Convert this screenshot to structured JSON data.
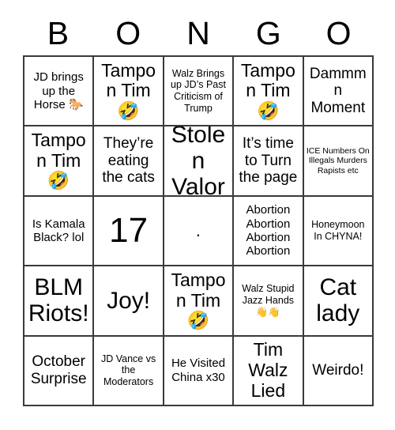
{
  "header": {
    "letters": [
      "B",
      "O",
      "N",
      "G",
      "O"
    ]
  },
  "grid": {
    "rows": 5,
    "columns": 5,
    "border_color": "#3a3a3a",
    "background": "#ffffff",
    "cells": [
      {
        "text": "JD brings up the Horse 🐎",
        "size": "s-md",
        "name": "bingo-cell-b1"
      },
      {
        "text": "Tampon Tim 🤣",
        "size": "s-xl",
        "name": "bingo-cell-o1"
      },
      {
        "text": "Walz Brings up JD’s Past Criticism of Trump",
        "size": "s-sm",
        "name": "bingo-cell-n1"
      },
      {
        "text": "Tampon Tim 🤣",
        "size": "s-xl",
        "name": "bingo-cell-g1"
      },
      {
        "text": "Dammmn Moment",
        "size": "s-lg",
        "name": "bingo-cell-o2"
      },
      {
        "text": "Tampon Tim 🤣",
        "size": "s-xl",
        "name": "bingo-cell-b2"
      },
      {
        "text": "They’re eating the cats",
        "size": "s-lg",
        "name": "bingo-cell-o3"
      },
      {
        "text": "Stolen Valor",
        "size": "s-xxl",
        "name": "bingo-cell-n2"
      },
      {
        "text": "It’s time to Turn the page",
        "size": "s-lg",
        "name": "bingo-cell-g2"
      },
      {
        "text": "ICE Numbers On Illegals Murders Rapists etc",
        "size": "s-xs",
        "name": "bingo-cell-o4"
      },
      {
        "text": "Is Kamala Black? lol",
        "size": "s-md",
        "name": "bingo-cell-b3"
      },
      {
        "text": "17",
        "size": "s-huge",
        "name": "bingo-cell-o5"
      },
      {
        "text": ".",
        "size": "s-dot",
        "name": "bingo-cell-free-center"
      },
      {
        "text": "Abortion Abortion Abortion Abortion",
        "size": "s-md",
        "name": "bingo-cell-g3"
      },
      {
        "text": "Honeymoon In CHYNA!",
        "size": "s-sm",
        "name": "bingo-cell-o6"
      },
      {
        "text": "BLM Riots!",
        "size": "s-xxl",
        "name": "bingo-cell-b4"
      },
      {
        "text": "Joy!",
        "size": "s-xxl",
        "name": "bingo-cell-o7"
      },
      {
        "text": "Tampon Tim 🤣",
        "size": "s-xl",
        "name": "bingo-cell-n3"
      },
      {
        "text": "Walz Stupid Jazz Hands 👋👋",
        "size": "s-sm",
        "name": "bingo-cell-g4"
      },
      {
        "text": "Cat lady",
        "size": "s-xxl",
        "name": "bingo-cell-o8"
      },
      {
        "text": "October Surprise",
        "size": "s-lg",
        "name": "bingo-cell-b5"
      },
      {
        "text": "JD Vance vs the Moderators",
        "size": "s-sm",
        "name": "bingo-cell-o9"
      },
      {
        "text": "He Visited China x30",
        "size": "s-md",
        "name": "bingo-cell-n4"
      },
      {
        "text": "Tim Walz Lied",
        "size": "s-xl",
        "name": "bingo-cell-g5"
      },
      {
        "text": "Weirdo!",
        "size": "s-lg",
        "name": "bingo-cell-o10"
      }
    ]
  }
}
